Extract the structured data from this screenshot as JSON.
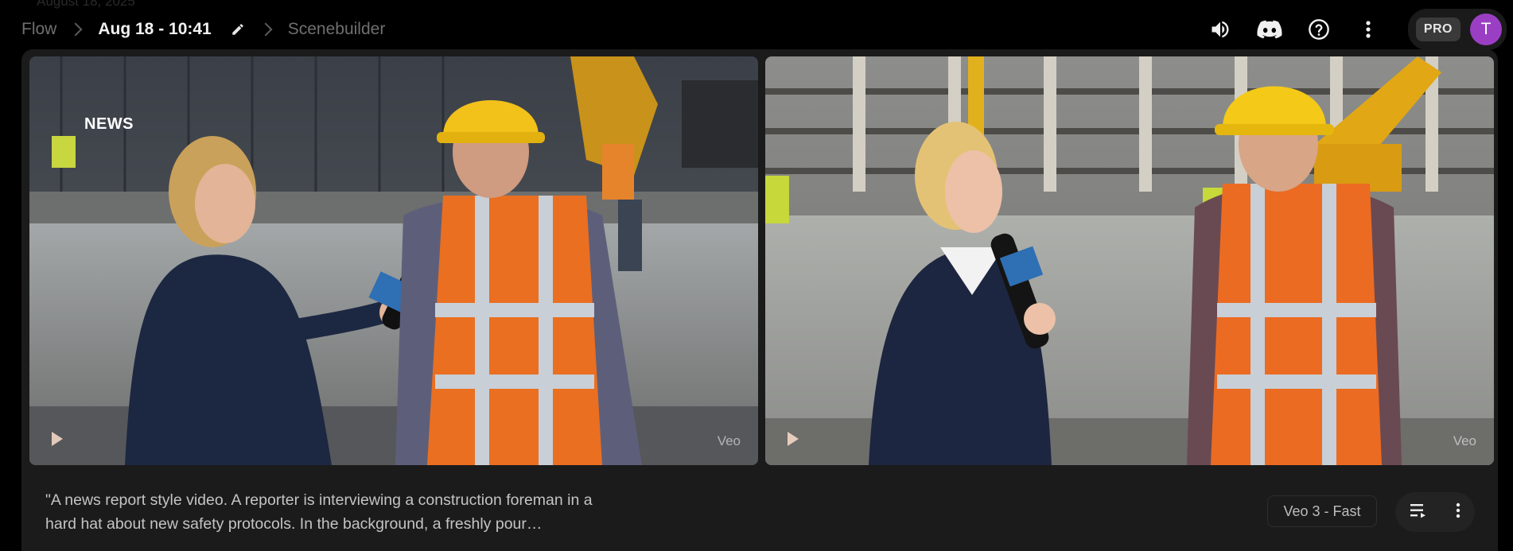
{
  "ghost_header": "August 18, 2025",
  "breadcrumb": {
    "root": "Flow",
    "project": "Aug 18 - 10:41",
    "section": "Scenebuilder"
  },
  "account": {
    "plan_badge": "PRO",
    "avatar_initial": "T",
    "avatar_color": "#9a3fc4"
  },
  "icons": {
    "sound": "volume-icon",
    "discord": "discord-icon",
    "help": "help-icon",
    "more": "more-vert-icon",
    "edit": "pencil-icon"
  },
  "clips": [
    {
      "overlay_text": "NEWS",
      "watermark": "Veo"
    },
    {
      "overlay_text": "",
      "watermark": "Veo"
    }
  ],
  "prompt_text": "\"A news report style video. A reporter is interviewing a construction foreman in a hard hat about new safety protocols. In the background, a freshly pour…",
  "model_label": "Veo 3 - Fast"
}
